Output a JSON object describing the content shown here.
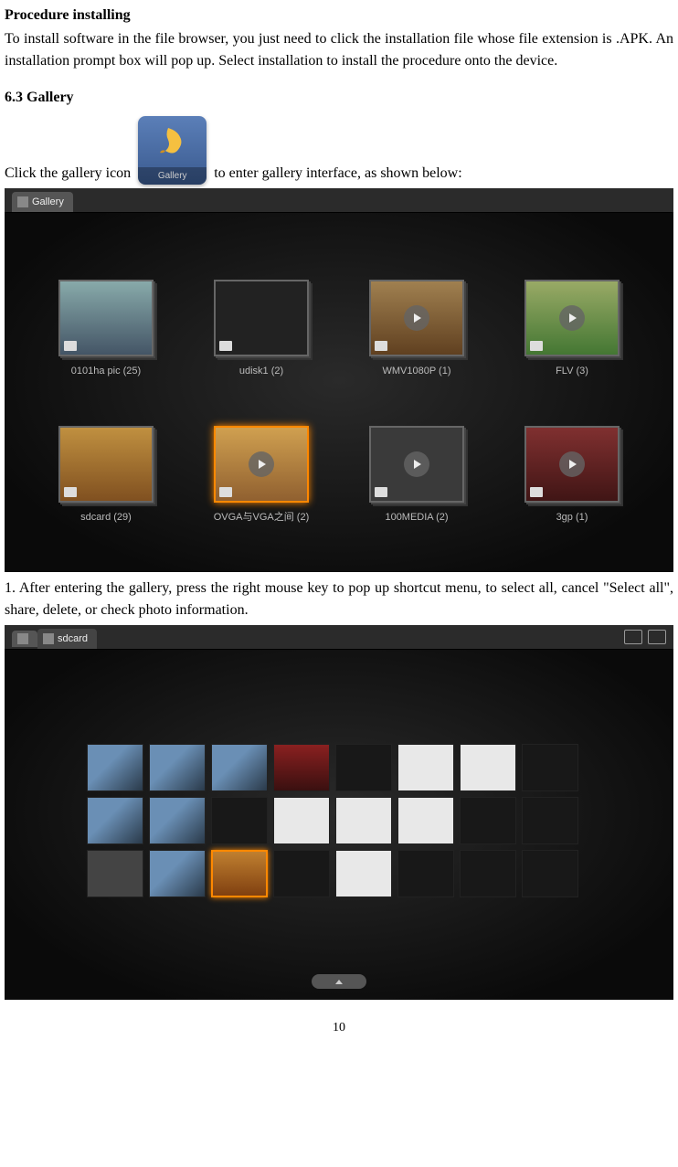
{
  "heading1": "Procedure installing",
  "body1": "To install software in the file browser, you just need to click the installation file whose file extension is .APK. An installation prompt box will pop up. Select installation to install the procedure onto the device.",
  "section": "6.3 Gallery",
  "iconLine": {
    "before": "Click the gallery icon",
    "label": "Gallery",
    "after": "to enter gallery interface, as shown below:"
  },
  "screenshot1": {
    "tab": "Gallery",
    "albums": [
      {
        "label": "0101ha pic (25)",
        "play": false,
        "highlighted": false
      },
      {
        "label": "udisk1 (2)",
        "play": false,
        "highlighted": false
      },
      {
        "label": "WMV1080P (1)",
        "play": true,
        "highlighted": false
      },
      {
        "label": "FLV (3)",
        "play": true,
        "highlighted": false
      },
      {
        "label": "sdcard (29)",
        "play": false,
        "highlighted": false
      },
      {
        "label": "OVGA与VGA之间 (2)",
        "play": true,
        "highlighted": true
      },
      {
        "label": "100MEDIA (2)",
        "play": true,
        "highlighted": false
      },
      {
        "label": "3gp (1)",
        "play": true,
        "highlighted": false
      }
    ]
  },
  "listItem1": "1. After entering the gallery, press the right mouse key to pop up shortcut menu, to select all, cancel \"Select all\", share, delete, or check photo information.",
  "screenshot2": {
    "tabs": [
      "",
      "sdcard"
    ]
  },
  "pageNumber": "10"
}
